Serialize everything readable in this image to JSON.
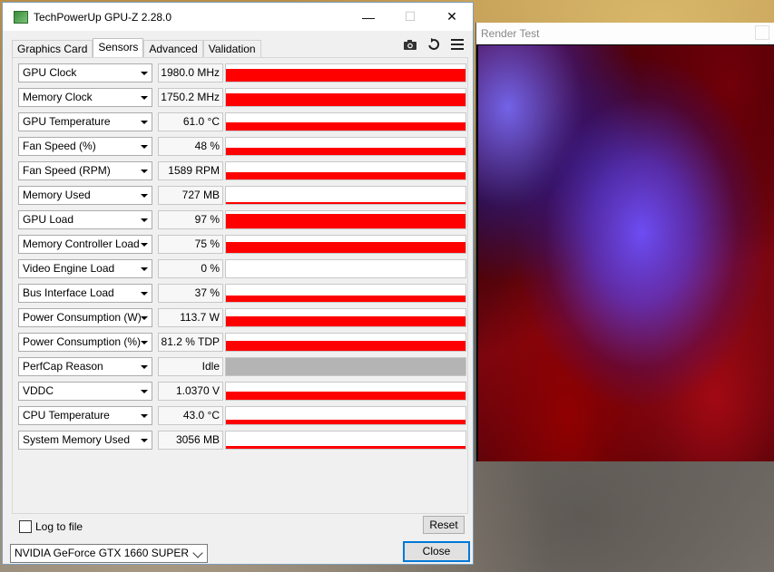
{
  "gpuz": {
    "title": "TechPowerUp GPU-Z 2.28.0",
    "tabs": [
      {
        "label": "Graphics Card",
        "active": false
      },
      {
        "label": "Sensors",
        "active": true
      },
      {
        "label": "Advanced",
        "active": false
      },
      {
        "label": "Validation",
        "active": false
      }
    ],
    "sensors": [
      {
        "name": "GPU Clock",
        "value": "1980.0 MHz",
        "level": 0.75,
        "style": "red"
      },
      {
        "name": "Memory Clock",
        "value": "1750.2 MHz",
        "level": 0.75,
        "style": "red"
      },
      {
        "name": "GPU Temperature",
        "value": "61.0 °C",
        "level": 0.45,
        "style": "red"
      },
      {
        "name": "Fan Speed (%)",
        "value": "48 %",
        "level": 0.4,
        "style": "red"
      },
      {
        "name": "Fan Speed (RPM)",
        "value": "1589 RPM",
        "level": 0.4,
        "style": "red"
      },
      {
        "name": "Memory Used",
        "value": "727 MB",
        "level": 0.1,
        "style": "red"
      },
      {
        "name": "GPU Load",
        "value": "97 %",
        "level": 0.85,
        "style": "red"
      },
      {
        "name": "Memory Controller Load",
        "value": "75 %",
        "level": 0.65,
        "style": "red"
      },
      {
        "name": "Video Engine Load",
        "value": "0 %",
        "level": 0.0,
        "style": "red"
      },
      {
        "name": "Bus Interface Load",
        "value": "37 %",
        "level": 0.35,
        "style": "red"
      },
      {
        "name": "Power Consumption (W)",
        "value": "113.7 W",
        "level": 0.6,
        "style": "red"
      },
      {
        "name": "Power Consumption (%)",
        "value": "81.2 % TDP",
        "level": 0.6,
        "style": "red"
      },
      {
        "name": "PerfCap Reason",
        "value": "Idle",
        "level": 1.0,
        "style": "gray"
      },
      {
        "name": "VDDC",
        "value": "1.0370 V",
        "level": 0.45,
        "style": "red"
      },
      {
        "name": "CPU Temperature",
        "value": "43.0 °C",
        "level": 0.25,
        "style": "red"
      },
      {
        "name": "System Memory Used",
        "value": "3056 MB",
        "level": 0.15,
        "style": "red"
      }
    ],
    "log_label": "Log to file",
    "reset_label": "Reset",
    "gpu_selected": "NVIDIA GeForce GTX 1660 SUPER",
    "close_label": "Close",
    "min_glyph": "—",
    "max_glyph": "☐",
    "close_glyph": "✕"
  },
  "render_test": {
    "title": "Render Test"
  }
}
